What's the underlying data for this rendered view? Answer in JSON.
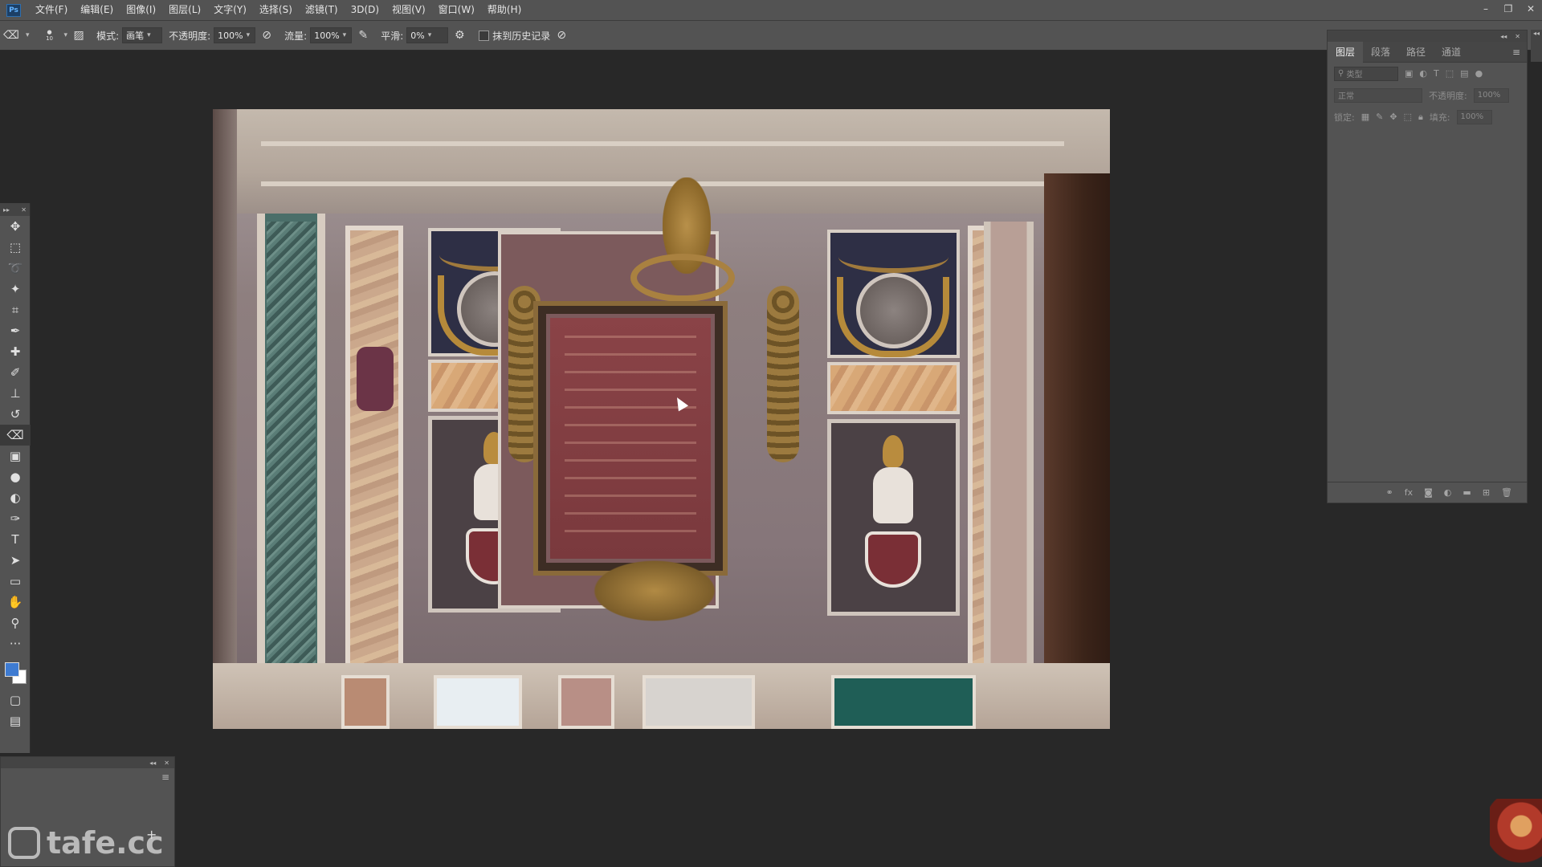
{
  "menubar": {
    "logo": "Ps",
    "items": [
      "文件(F)",
      "编辑(E)",
      "图像(I)",
      "图层(L)",
      "文字(Y)",
      "选择(S)",
      "滤镜(T)",
      "3D(D)",
      "视图(V)",
      "窗口(W)",
      "帮助(H)"
    ],
    "window_controls": [
      "–",
      "❐",
      "✕"
    ]
  },
  "options": {
    "brush_size": "10",
    "mode_label": "模式:",
    "mode_value": "画笔",
    "opacity_label": "不透明度:",
    "opacity_value": "100%",
    "flow_label": "流量:",
    "flow_value": "100%",
    "smoothing_label": "平滑:",
    "smoothing_value": "0%",
    "history_label": "抹到历史记录"
  },
  "layers_panel": {
    "tabs": [
      "图层",
      "段落",
      "路径",
      "通道"
    ],
    "active_tab": "图层",
    "filter_placeholder": "类型",
    "blend_mode": "正常",
    "opacity_label": "不透明度:",
    "opacity_value": "100%",
    "lock_label": "锁定:",
    "fill_label": "填充:",
    "fill_value": "100%"
  },
  "watermark": {
    "text": "tafe.cc"
  },
  "colors": {
    "foreground": "#3e7bd1",
    "background": "#ffffff",
    "ui_panel": "#535353",
    "workspace": "#282828"
  },
  "icons": {
    "tools": [
      "move-icon",
      "marquee-icon",
      "lasso-icon",
      "magic-wand-icon",
      "crop-icon",
      "eyedropper-icon",
      "healing-icon",
      "brush-icon",
      "stamp-icon",
      "history-brush-icon",
      "eraser-icon",
      "gradient-icon",
      "blur-icon",
      "dodge-icon",
      "pen-icon",
      "type-icon",
      "path-select-icon",
      "rectangle-icon",
      "hand-icon",
      "zoom-icon",
      "more-icon"
    ]
  }
}
